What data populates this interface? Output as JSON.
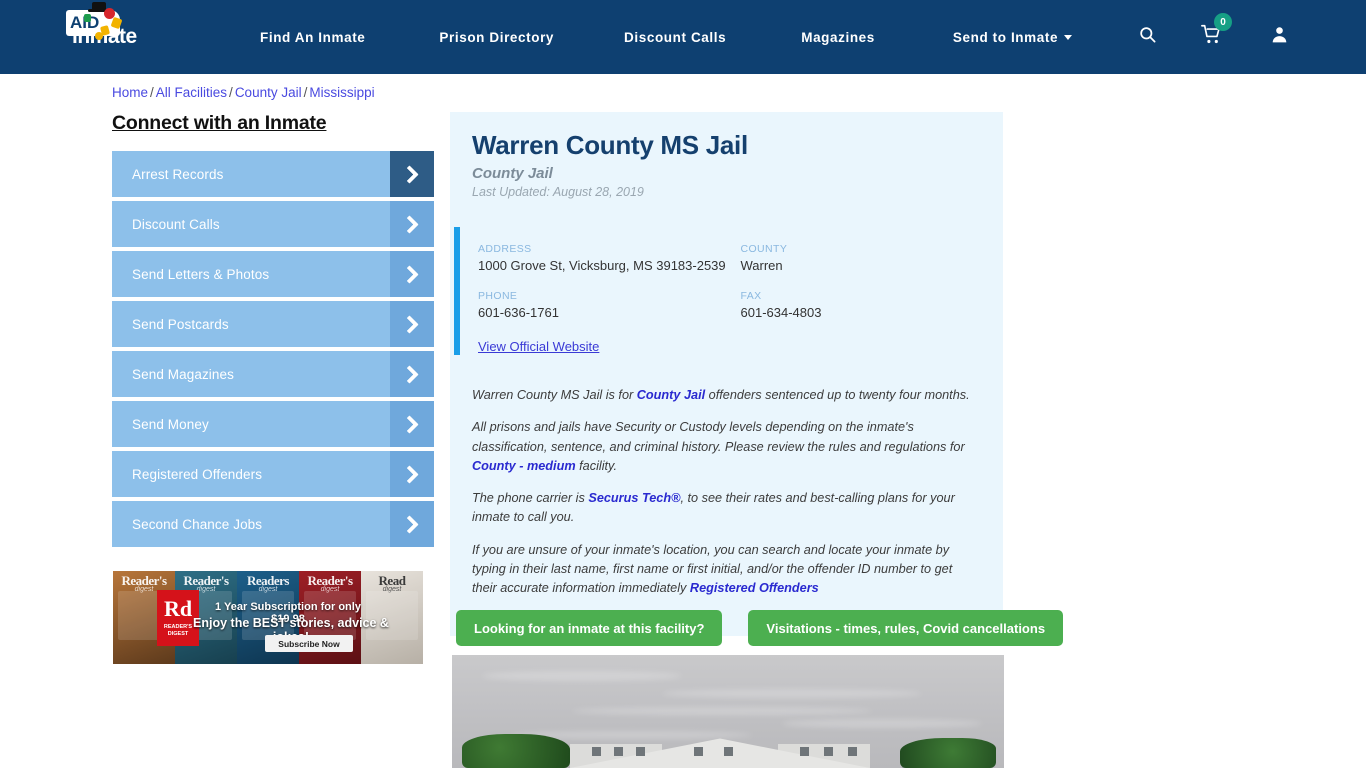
{
  "header": {
    "logo_text": "inmate",
    "logo_badge": "AID",
    "nav": [
      {
        "label": "Find An Inmate"
      },
      {
        "label": "Prison Directory"
      },
      {
        "label": "Discount Calls"
      },
      {
        "label": "Magazines"
      },
      {
        "label": "Send to Inmate"
      }
    ],
    "cart_count": "0",
    "brand_color": "#0e4071"
  },
  "breadcrumb": {
    "home": "Home",
    "all_facilities": "All Facilities",
    "county_jail": "County Jail",
    "state": "Mississippi",
    "separator": "/"
  },
  "sidebar": {
    "heading": "Connect with an Inmate",
    "items": [
      {
        "label": "Arrest Records",
        "active": true
      },
      {
        "label": "Discount Calls",
        "active": false
      },
      {
        "label": "Send Letters & Photos",
        "active": false
      },
      {
        "label": "Send Postcards",
        "active": false
      },
      {
        "label": "Send Magazines",
        "active": false
      },
      {
        "label": "Send Money",
        "active": false
      },
      {
        "label": "Registered Offenders",
        "active": false
      },
      {
        "label": "Second Chance Jobs",
        "active": false
      }
    ],
    "ad": {
      "brand_initials": "Rd",
      "brand_name": "READER'S DIGEST",
      "line1": "1 Year Subscription for only $19.98",
      "line2": "Enjoy the BEST stories, advice & jokes!",
      "cta": "Subscribe Now",
      "covers": [
        {
          "title": "Reader's",
          "sub": "digest"
        },
        {
          "title": "Reader's",
          "sub": "digest"
        },
        {
          "title": "Readers",
          "sub": "digest"
        },
        {
          "title": "Reader's",
          "sub": "digest"
        },
        {
          "title": "Read",
          "sub": "digest"
        }
      ]
    }
  },
  "facility": {
    "name": "Warren County MS Jail",
    "type": "County Jail",
    "last_updated": "Last Updated: August 28, 2019",
    "address_label": "ADDRESS",
    "address_value": "1000 Grove St, Vicksburg, MS 39183-2539",
    "county_label": "COUNTY",
    "county_value": "Warren",
    "phone_label": "PHONE",
    "phone_value": "601-636-1761",
    "fax_label": "FAX",
    "fax_value": "601-634-4803",
    "website_link": "View Official Website",
    "accent_color": "#1a9ee8"
  },
  "description": {
    "p1_a": "Warren County MS Jail is for ",
    "p1_link": "County Jail",
    "p1_b": " offenders sentenced up to twenty four months.",
    "p2_a": "All prisons and jails have Security or Custody levels depending on the inmate's classification, sentence, and criminal history. Please review the rules and regulations for ",
    "p2_link": "County - medium",
    "p2_b": " facility.",
    "p3_a": "The phone carrier is ",
    "p3_link": "Securus Tech®",
    "p3_b": ", to see their rates and best-calling plans for your inmate to call you.",
    "p4_a": "If you are unsure of your inmate's location, you can search and locate your inmate by typing in their last name, first name or first initial, and/or the offender ID number to get their accurate information immediately ",
    "p4_link": "Registered Offenders"
  },
  "actions": {
    "inmate_search": "Looking for an inmate at this facility?",
    "visitations": "Visitations - times, rules, Covid cancellations",
    "button_color": "#4caf50"
  }
}
